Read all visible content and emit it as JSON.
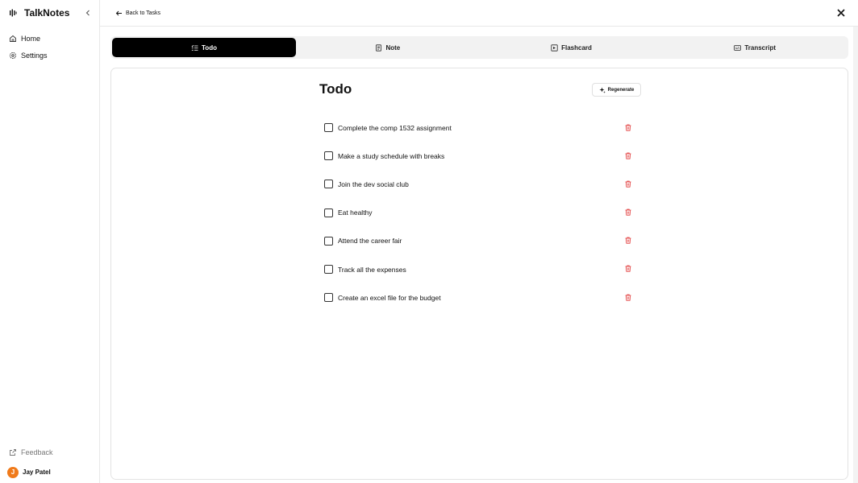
{
  "app": {
    "name": "TalkNotes"
  },
  "sidebar": {
    "nav": [
      {
        "label": "Home",
        "icon": "home-icon"
      },
      {
        "label": "Settings",
        "icon": "gear-icon"
      }
    ],
    "feedback_label": "Feedback",
    "user": {
      "initial": "J",
      "name": "Jay Patel",
      "avatar_color": "#f07a1a"
    }
  },
  "header": {
    "back_label": "Back to Tasks"
  },
  "tabs": [
    {
      "label": "Todo",
      "icon": "list-check-icon",
      "active": true
    },
    {
      "label": "Note",
      "icon": "document-icon",
      "active": false
    },
    {
      "label": "Flashcard",
      "icon": "flashcard-icon",
      "active": false
    },
    {
      "label": "Transcript",
      "icon": "transcript-icon",
      "active": false
    }
  ],
  "todo": {
    "title": "Todo",
    "regenerate_label": "Regenerate",
    "items": [
      {
        "text": "Complete the comp 1532 assignment",
        "checked": false
      },
      {
        "text": "Make a study schedule with breaks",
        "checked": false
      },
      {
        "text": "Join the dev social club",
        "checked": false
      },
      {
        "text": "Eat healthy",
        "checked": false
      },
      {
        "text": "Attend the career fair",
        "checked": false
      },
      {
        "text": "Track all the expenses",
        "checked": false
      },
      {
        "text": "Create an excel file for the budget",
        "checked": false
      }
    ]
  },
  "colors": {
    "accent": "#000000",
    "delete": "#e03131",
    "avatar": "#f07a1a"
  }
}
